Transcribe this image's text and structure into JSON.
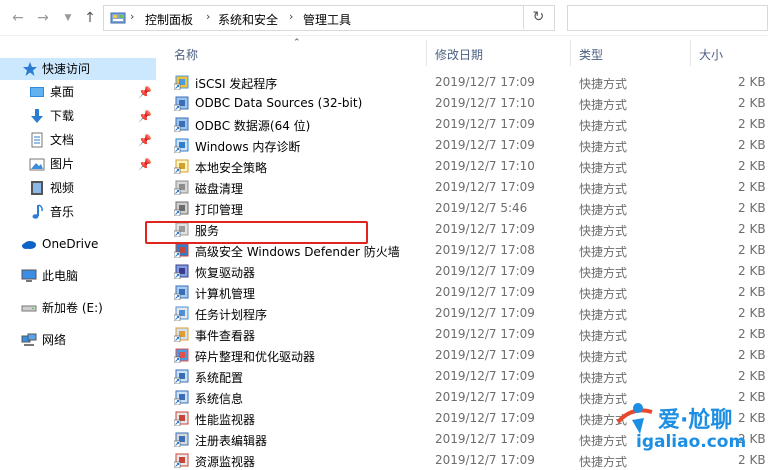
{
  "address_bar": {
    "back_icon": "arrow-left-icon",
    "forward_icon": "arrow-right-icon",
    "recent_icon": "chevron-down-icon",
    "up_icon": "arrow-up-icon",
    "breadcrumbs": [
      "控制面板",
      "系统和安全",
      "管理工具"
    ],
    "refresh_icon": "refresh-icon",
    "search_placeholder": ""
  },
  "sidebar": {
    "items": [
      {
        "label": "快速访问",
        "icon": "star-icon",
        "selected": true
      },
      {
        "label": "桌面",
        "icon": "desktop-icon",
        "pinned": true
      },
      {
        "label": "下载",
        "icon": "download-icon",
        "pinned": true
      },
      {
        "label": "文档",
        "icon": "document-icon",
        "pinned": true
      },
      {
        "label": "图片",
        "icon": "picture-icon",
        "pinned": true
      },
      {
        "label": "视频",
        "icon": "video-icon"
      },
      {
        "label": "音乐",
        "icon": "music-icon"
      },
      {
        "label": "OneDrive",
        "icon": "cloud-icon"
      },
      {
        "label": "此电脑",
        "icon": "computer-icon"
      },
      {
        "label": "新加卷 (E:)",
        "icon": "drive-icon"
      },
      {
        "label": "网络",
        "icon": "network-icon"
      }
    ]
  },
  "columns": {
    "name": "名称",
    "date": "修改日期",
    "type": "类型",
    "size": "大小"
  },
  "files": [
    {
      "name": "iSCSI 发起程序",
      "date": "2019/12/7 17:09",
      "type": "快捷方式",
      "size": "2 KB"
    },
    {
      "name": "ODBC Data Sources (32-bit)",
      "date": "2019/12/7 17:10",
      "type": "快捷方式",
      "size": "2 KB"
    },
    {
      "name": "ODBC 数据源(64 位)",
      "date": "2019/12/7 17:09",
      "type": "快捷方式",
      "size": "2 KB"
    },
    {
      "name": "Windows 内存诊断",
      "date": "2019/12/7 17:09",
      "type": "快捷方式",
      "size": "2 KB"
    },
    {
      "name": "本地安全策略",
      "date": "2019/12/7 17:10",
      "type": "快捷方式",
      "size": "2 KB"
    },
    {
      "name": "磁盘清理",
      "date": "2019/12/7 17:09",
      "type": "快捷方式",
      "size": "2 KB"
    },
    {
      "name": "打印管理",
      "date": "2019/12/7 5:46",
      "type": "快捷方式",
      "size": "2 KB"
    },
    {
      "name": "服务",
      "date": "2019/12/7 17:09",
      "type": "快捷方式",
      "size": "2 KB"
    },
    {
      "name": "高级安全 Windows Defender 防火墙",
      "date": "2019/12/7 17:08",
      "type": "快捷方式",
      "size": "2 KB"
    },
    {
      "name": "恢复驱动器",
      "date": "2019/12/7 17:09",
      "type": "快捷方式",
      "size": "2 KB"
    },
    {
      "name": "计算机管理",
      "date": "2019/12/7 17:09",
      "type": "快捷方式",
      "size": "2 KB"
    },
    {
      "name": "任务计划程序",
      "date": "2019/12/7 17:09",
      "type": "快捷方式",
      "size": "2 KB"
    },
    {
      "name": "事件查看器",
      "date": "2019/12/7 17:09",
      "type": "快捷方式",
      "size": "2 KB"
    },
    {
      "name": "碎片整理和优化驱动器",
      "date": "2019/12/7 17:09",
      "type": "快捷方式",
      "size": "2 KB"
    },
    {
      "name": "系统配置",
      "date": "2019/12/7 17:09",
      "type": "快捷方式",
      "size": "2 KB"
    },
    {
      "name": "系统信息",
      "date": "2019/12/7 17:09",
      "type": "快捷方式",
      "size": "2 KB"
    },
    {
      "name": "性能监视器",
      "date": "2019/12/7 17:09",
      "type": "快捷方式",
      "size": "2 KB"
    },
    {
      "name": "注册表编辑器",
      "date": "2019/12/7 17:09",
      "type": "快捷方式",
      "size": "2 KB"
    },
    {
      "name": "资源监视器",
      "date": "2019/12/7 17:09",
      "type": "快捷方式",
      "size": "2 KB"
    }
  ],
  "highlighted_item": "服务",
  "watermark": {
    "title": "爱·尬聊",
    "url": "igaliao.com"
  },
  "colors": {
    "selected_bg": "#cce8ff",
    "highlight_border": "#e0251f",
    "header_text": "#4d6082",
    "meta_text": "#6d6d6d",
    "watermark": "#1c8fe3"
  }
}
